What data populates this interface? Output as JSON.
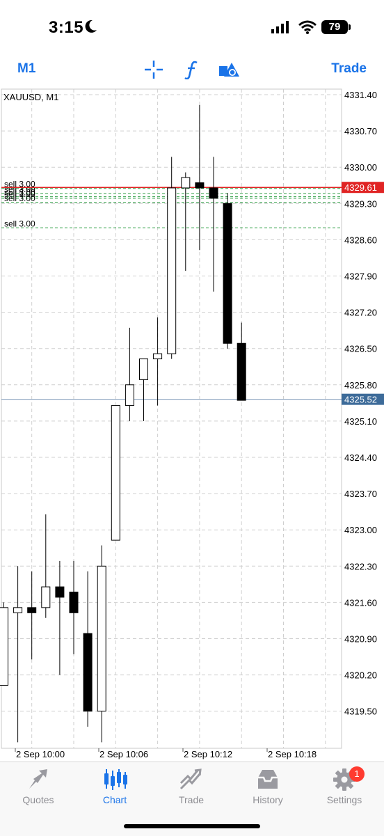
{
  "status": {
    "time": "3:15",
    "battery": "79"
  },
  "toolbar": {
    "timeframe": "M1",
    "trade": "Trade"
  },
  "chart": {
    "symbol_label": "XAUUSD, M1",
    "price_ticks": [
      "4331.40",
      "4330.70",
      "4330.00",
      "4329.30",
      "4328.60",
      "4327.90",
      "4327.20",
      "4326.50",
      "4325.80",
      "4325.10",
      "4324.40",
      "4323.70",
      "4323.00",
      "4322.30",
      "4321.60",
      "4320.90",
      "4320.20",
      "4319.50"
    ],
    "time_ticks": [
      "2 Sep 10:00",
      "2 Sep 10:06",
      "2 Sep 10:12",
      "2 Sep 10:18"
    ],
    "ask_label": "4329.61",
    "bid_label": "4325.52",
    "order_labels": [
      "sell 3.00",
      "sell 3.00",
      "sell 3.00",
      "sell 3.00",
      "sell 3.00",
      "sell 3.00"
    ]
  },
  "chart_data": {
    "type": "candlestick",
    "title": "XAUUSD, M1",
    "ylim": [
      4318.7,
      4331.6
    ],
    "candles": [
      {
        "time": "09:57",
        "open": 4320.0,
        "high": 4321.6,
        "low": 4320.0,
        "close": 4321.5
      },
      {
        "time": "09:58",
        "open": 4321.4,
        "high": 4322.3,
        "low": 4318.9,
        "close": 4321.5
      },
      {
        "time": "09:59",
        "open": 4321.5,
        "high": 4322.2,
        "low": 4320.5,
        "close": 4321.4
      },
      {
        "time": "10:00",
        "open": 4321.5,
        "high": 4323.3,
        "low": 4321.3,
        "close": 4321.9
      },
      {
        "time": "10:01",
        "open": 4321.9,
        "high": 4322.4,
        "low": 4320.2,
        "close": 4321.7
      },
      {
        "time": "10:02",
        "open": 4321.8,
        "high": 4322.4,
        "low": 4320.6,
        "close": 4321.4
      },
      {
        "time": "10:03",
        "open": 4321.0,
        "high": 4322.2,
        "low": 4319.2,
        "close": 4319.5
      },
      {
        "time": "10:04",
        "open": 4319.5,
        "high": 4322.7,
        "low": 4318.9,
        "close": 4322.3
      },
      {
        "time": "10:05",
        "open": 4322.8,
        "high": 4325.3,
        "low": 4322.8,
        "close": 4325.4
      },
      {
        "time": "10:06",
        "open": 4325.4,
        "high": 4326.9,
        "low": 4325.1,
        "close": 4325.8
      },
      {
        "time": "10:07",
        "open": 4325.9,
        "high": 4326.3,
        "low": 4325.1,
        "close": 4326.3
      },
      {
        "time": "10:08",
        "open": 4326.3,
        "high": 4327.1,
        "low": 4325.4,
        "close": 4326.4
      },
      {
        "time": "10:09",
        "open": 4326.4,
        "high": 4330.2,
        "low": 4326.3,
        "close": 4329.6
      },
      {
        "time": "10:10",
        "open": 4329.6,
        "high": 4329.9,
        "low": 4328.0,
        "close": 4329.8
      },
      {
        "time": "10:11",
        "open": 4329.7,
        "high": 4331.2,
        "low": 4328.4,
        "close": 4329.6
      },
      {
        "time": "10:12",
        "open": 4329.6,
        "high": 4330.2,
        "low": 4327.6,
        "close": 4329.4
      },
      {
        "time": "10:13",
        "open": 4329.3,
        "high": 4329.5,
        "low": 4326.5,
        "close": 4326.6
      },
      {
        "time": "10:14",
        "open": 4326.6,
        "high": 4327.0,
        "low": 4325.5,
        "close": 4325.5
      }
    ],
    "ask": 4329.61,
    "bid": 4325.52,
    "sell_orders": [
      4329.59,
      4329.49,
      4329.43,
      4329.4,
      4329.32,
      4328.83
    ]
  },
  "tabs": [
    {
      "label": "Quotes",
      "icon": "quotes-icon"
    },
    {
      "label": "Chart",
      "icon": "chart-icon"
    },
    {
      "label": "Trade",
      "icon": "trade-icon"
    },
    {
      "label": "History",
      "icon": "history-icon"
    },
    {
      "label": "Settings",
      "icon": "settings-icon",
      "badge": "1"
    }
  ],
  "colors": {
    "accent": "#1a73e8",
    "ask": "#e02424",
    "bid": "#3d6b99",
    "grid": "#cfcfcf",
    "order": "#2e9e44"
  }
}
